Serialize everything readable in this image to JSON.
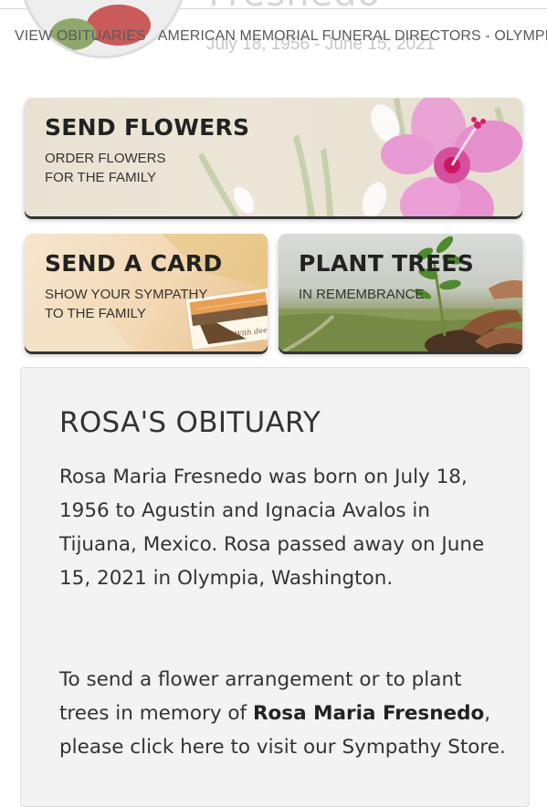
{
  "header": {
    "name_fragment": "Fresnedo",
    "dates": "July 18, 1956 - June 15, 2021",
    "breadcrumbs": [
      "VIEW OBITUARIES",
      "AMERICAN MEMORIAL FUNERAL DIRECTORS - OLYMPIA"
    ]
  },
  "banners": {
    "flowers": {
      "title": "SEND FLOWERS",
      "line1": "ORDER FLOWERS",
      "line2": "FOR THE FAMILY"
    },
    "card": {
      "title": "SEND A CARD",
      "line1": "SHOW YOUR SYMPATHY",
      "line2": "TO THE FAMILY",
      "card_script": "With deepest Sympathy"
    },
    "trees": {
      "title": "PLANT TREES",
      "line1": "IN REMEMBRANCE"
    }
  },
  "obituary": {
    "heading": "ROSA'S OBITUARY",
    "paragraph1": "Rosa Maria Fresnedo was born on July 18, 1956 to Agustin and Ignacia Avalos in Tijuana, Mexico. Rosa passed away on June 15, 2021 in Olympia, Washington.",
    "p2_before": "To send a flower arrangement or to plant trees in memory of ",
    "p2_name": "Rosa Maria Fresnedo",
    "p2_after": ", please click here to visit our Sympathy Store."
  },
  "colors": {
    "hibiscus_pink": "#e889c9",
    "hibiscus_center": "#d8206a",
    "leaf_green": "#8fb76b",
    "text_dark": "#333333"
  },
  "icons": [
    "hibiscus-flower-image",
    "sympathy-card-image",
    "seedling-hands-image"
  ]
}
